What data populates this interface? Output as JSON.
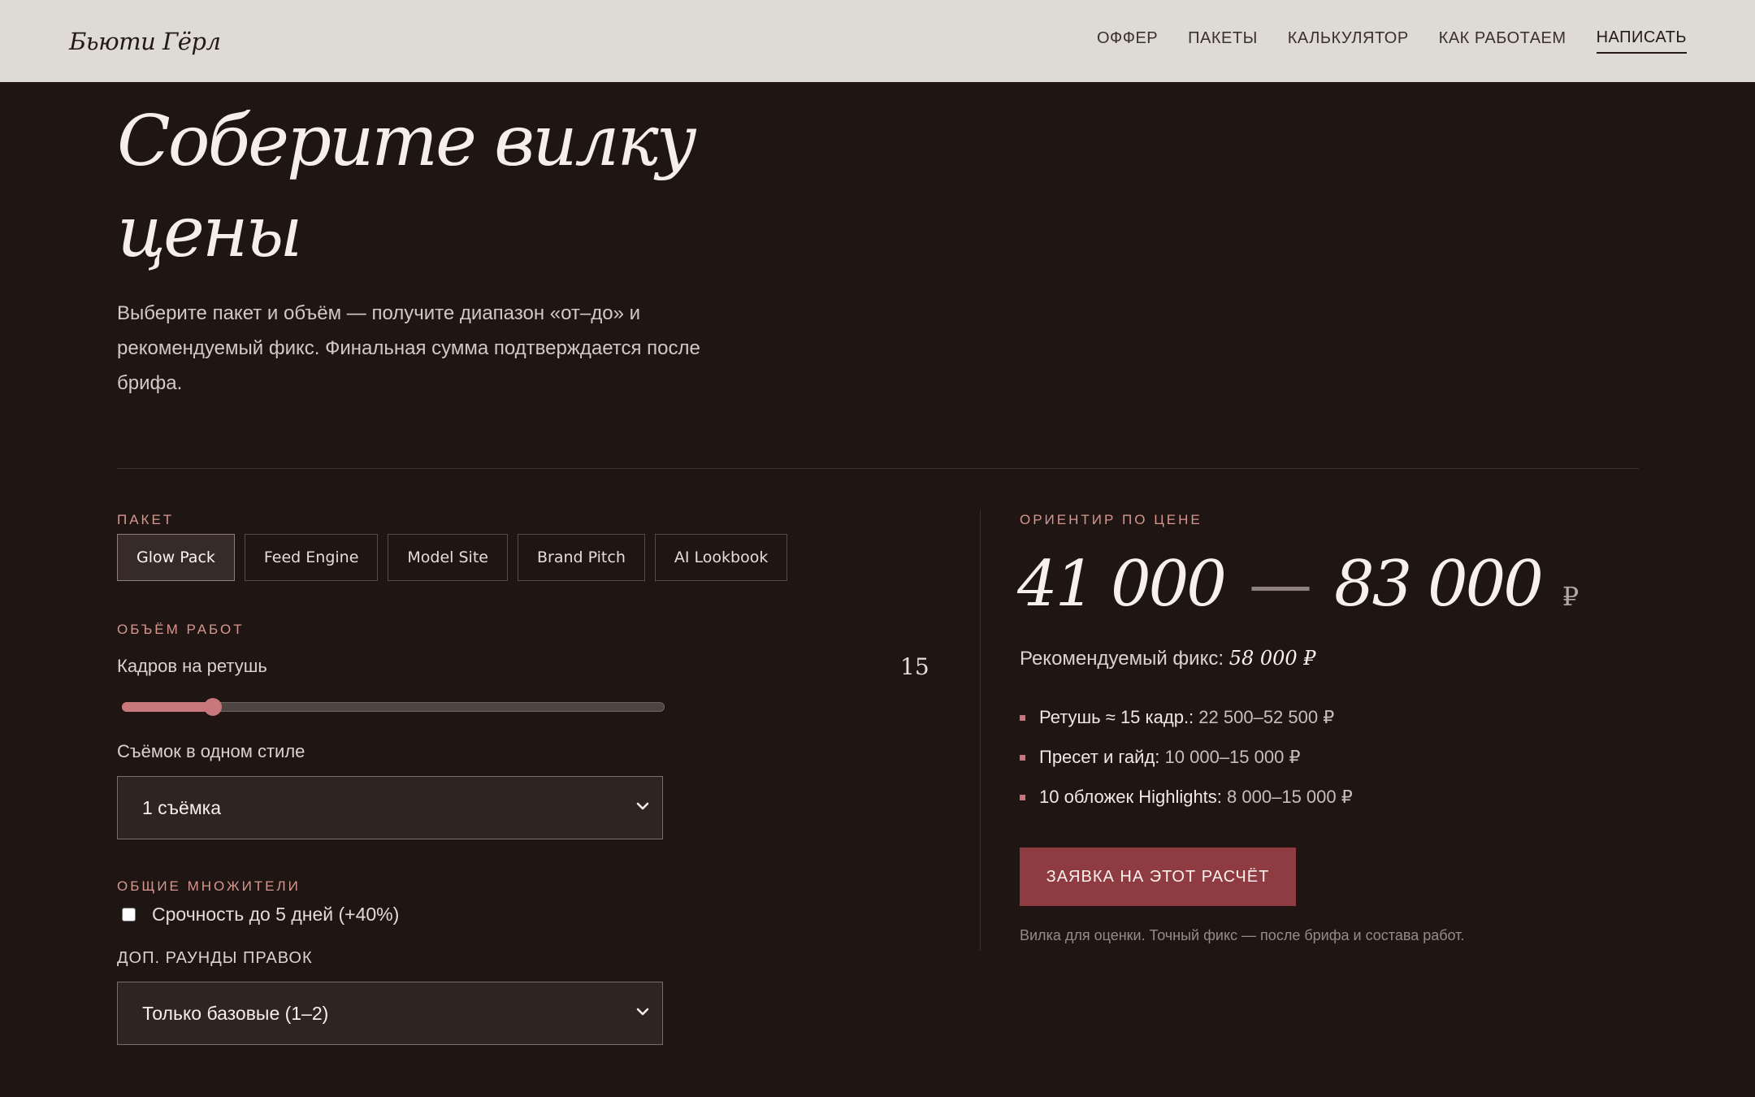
{
  "header": {
    "logo": "Бьюти Гёрл",
    "nav": [
      "ОФФЕР",
      "ПАКЕТЫ",
      "КАЛЬКУЛЯТОР",
      "КАК РАБОТАЕМ"
    ],
    "cta": "НАПИСАТЬ"
  },
  "hero": {
    "title": "Соберите вилку цены",
    "lead": "Выберите пакет и объём — получите диапазон «от–до» и рекомендуемый фикс. Финальная сумма подтверждается после брифа."
  },
  "calculator": {
    "package_label": "ПАКЕТ",
    "packages": [
      "Glow Pack",
      "Feed Engine",
      "Model Site",
      "Brand Pitch",
      "AI Lookbook"
    ],
    "active_package": "Glow Pack",
    "volume_label": "ОБЪЁМ РАБОТ",
    "retouch_label": "Кадров на ретушь",
    "retouch_value": "15",
    "retouch_slider": {
      "value": 15,
      "min": 5,
      "max": 100
    },
    "shoots_label": "Съёмок в одном стиле",
    "shoots_value": "1 съёмка",
    "multipliers_label": "ОБЩИЕ МНОЖИТЕЛИ",
    "urgency_label": "Срочность до 5 дней (+40%)",
    "urgency_checked": false,
    "rounds_label": "ДОП. РАУНДЫ ПРАВОК",
    "rounds_value": "Только базовые (1–2)"
  },
  "result": {
    "label": "ОРИЕНТИР ПО ЦЕНЕ",
    "price_from": "41 000",
    "price_dash": "—",
    "price_to": "83 000",
    "currency": "₽",
    "recommended_label": "Рекомендуемый фикс:",
    "recommended_value": "58 000 ₽",
    "breakdown": [
      {
        "key": "Ретушь ≈ 15 кадр.:",
        "value": "22 500–52 500 ₽"
      },
      {
        "key": "Пресет и гайд:",
        "value": "10 000–15 000 ₽"
      },
      {
        "key": "10 обложек Highlights:",
        "value": "8 000–15 000 ₽"
      }
    ],
    "cta": "ЗАЯВКА НА ЭТОТ РАСЧЁТ",
    "note": "Вилка для оценки. Точный фикс — после брифа и состава работ."
  },
  "colors": {
    "background": "#1f1513",
    "header": "#dedad6",
    "accent": "#c8787a",
    "button": "#8f3b42"
  }
}
